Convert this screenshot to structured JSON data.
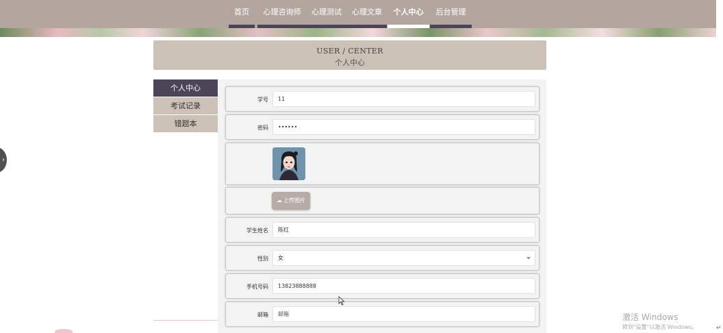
{
  "nav": {
    "items": [
      {
        "label": "首页"
      },
      {
        "label": "心理咨询师"
      },
      {
        "label": "心理测试"
      },
      {
        "label": "心理文章"
      },
      {
        "label": "个人中心"
      },
      {
        "label": "后台管理"
      }
    ],
    "active": "个人中心"
  },
  "heading": {
    "en": "USER / CENTER",
    "cn": "个人中心"
  },
  "side_menu": {
    "items": [
      {
        "label": "个人中心"
      },
      {
        "label": "考试记录"
      },
      {
        "label": "错题本"
      }
    ],
    "active": "个人中心"
  },
  "form": {
    "student_id": {
      "label": "学号",
      "value": "11"
    },
    "password": {
      "label": "密码",
      "value": "••••••"
    },
    "avatar": {
      "icon": "avatar-image"
    },
    "upload": {
      "label": "上传图片",
      "icon": "cloud-upload-icon"
    },
    "name": {
      "label": "学生姓名",
      "value": "陈红"
    },
    "gender": {
      "label": "性别",
      "value": "女"
    },
    "phone": {
      "label": "手机号码",
      "value": "13823888888"
    },
    "email": {
      "label": "邮箱",
      "placeholder": "邮箱"
    }
  },
  "watermark": {
    "title": "激活 Windows",
    "subtitle": "转到\"设置\"以激活 Windows。"
  },
  "colors": {
    "nav_bg": "#b3a69f",
    "heading_bg": "#cbc1b7",
    "side_active_bg": "#4c4558",
    "form_bg": "#f3f3f3"
  }
}
